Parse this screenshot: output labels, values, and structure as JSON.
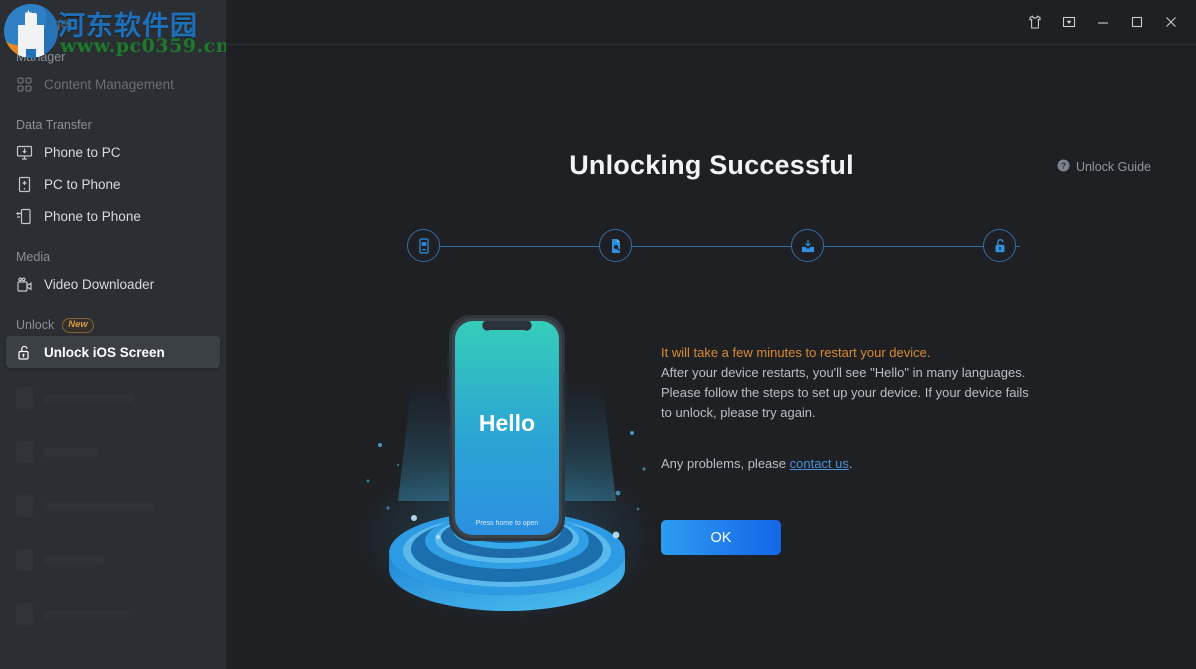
{
  "app": {
    "brand_title": "Manager",
    "watermark": {
      "cn_text": "河东软件园",
      "url_text": "www.pc0359.cn"
    }
  },
  "titlebar": {
    "buttons": [
      {
        "name": "skin-icon",
        "label": "Skin"
      },
      {
        "name": "menu-dropdown-icon",
        "label": "Menu"
      },
      {
        "name": "minimize-icon",
        "label": "Minimize"
      },
      {
        "name": "maximize-icon",
        "label": "Maximize"
      },
      {
        "name": "close-icon",
        "label": "Close"
      }
    ]
  },
  "sidebar": {
    "groups": [
      {
        "label": "Manager",
        "badge": "",
        "items": [
          {
            "label": "Content Management",
            "icon": "grid-icon",
            "state": "disabled"
          }
        ]
      },
      {
        "label": "Data Transfer",
        "badge": "",
        "items": [
          {
            "label": "Phone to PC",
            "icon": "phone-to-pc-icon",
            "state": "normal"
          },
          {
            "label": "PC to Phone",
            "icon": "pc-to-phone-icon",
            "state": "normal"
          },
          {
            "label": "Phone to Phone",
            "icon": "phone-to-phone-icon",
            "state": "normal"
          }
        ]
      },
      {
        "label": "Media",
        "badge": "",
        "items": [
          {
            "label": "Video Downloader",
            "icon": "video-camera-icon",
            "state": "normal"
          }
        ]
      },
      {
        "label": "Unlock",
        "badge": "New",
        "items": [
          {
            "label": "Unlock iOS Screen",
            "icon": "unlock-padlock-icon",
            "state": "active"
          }
        ]
      }
    ]
  },
  "main": {
    "title": "Unlocking Successful",
    "guide_link": "Unlock Guide",
    "stepper": {
      "steps": [
        {
          "name": "connect-device-step",
          "icon": "phone-cpu-icon"
        },
        {
          "name": "select-firmware-step",
          "icon": "firmware-file-icon"
        },
        {
          "name": "download-firmware-step",
          "icon": "download-tray-icon"
        },
        {
          "name": "unlock-step",
          "icon": "unlock-padlock-icon"
        }
      ]
    },
    "illustration": {
      "screen_text": "Hello",
      "screen_subtext": "Press home to open"
    },
    "messages": {
      "warning": "It will take a few minutes to restart your device.",
      "body_line1": "After your device restarts, you'll see \"Hello\" in many languages.",
      "body_line2": "Please follow the steps to set up your device. If your device fails",
      "body_line3": "to unlock, please try again.",
      "contact_prefix": "Any problems, please ",
      "contact_link": "contact us",
      "contact_suffix": "."
    },
    "ok_button": "OK"
  },
  "colors": {
    "accent_blue": "#2d9cf0",
    "warning_orange": "#d98b33",
    "link_blue": "#4a90d9",
    "sidebar_bg": "#2b2e33",
    "main_bg": "#1e2024"
  }
}
